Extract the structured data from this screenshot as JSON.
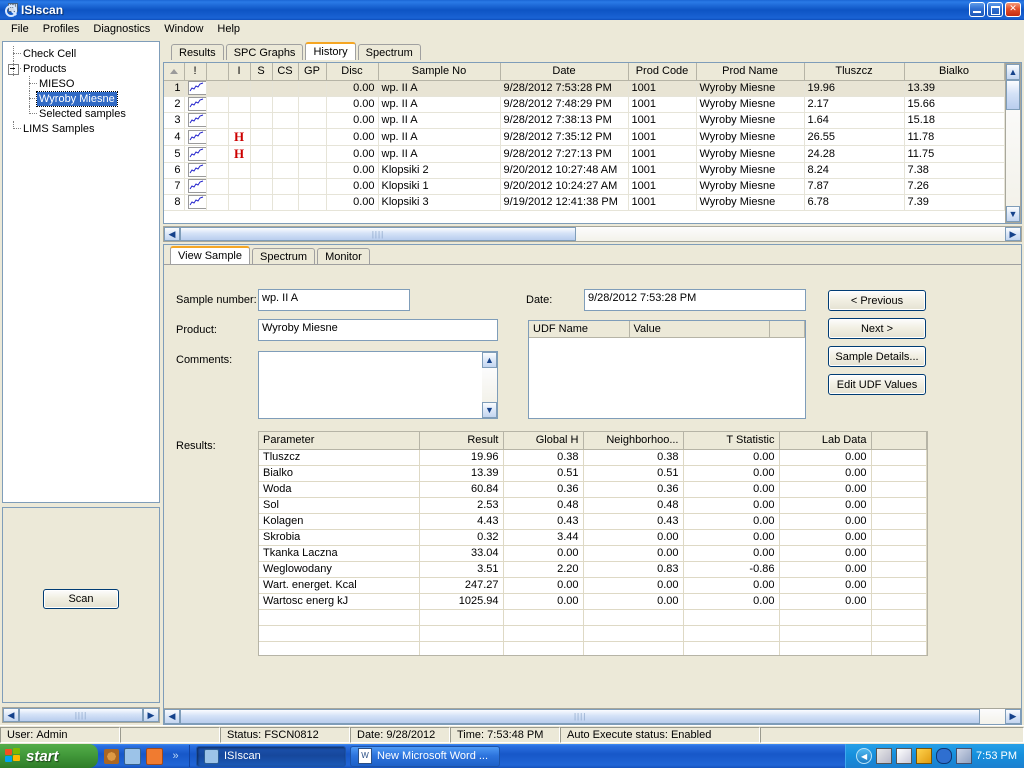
{
  "window": {
    "title": "ISIscan",
    "app_icon": "magnifier-isi-icon",
    "minimize_label": "Minimize",
    "restore_label": "Restore",
    "close_label": "Close"
  },
  "menu": [
    "File",
    "Profiles",
    "Diagnostics",
    "Window",
    "Help"
  ],
  "tree": [
    {
      "label": "Check Cell",
      "level": 1,
      "selected": false,
      "expander": false
    },
    {
      "label": "Products",
      "level": 1,
      "selected": false,
      "expander": true
    },
    {
      "label": "MIESO",
      "level": 2,
      "selected": false,
      "expander": false
    },
    {
      "label": "Wyroby Miesne",
      "level": 2,
      "selected": true,
      "expander": false
    },
    {
      "label": "Selected samples",
      "level": 2,
      "selected": false,
      "expander": false
    },
    {
      "label": "LIMS Samples",
      "level": 1,
      "selected": false,
      "expander": false
    }
  ],
  "scan": {
    "label": "Scan"
  },
  "main_tabs": [
    {
      "label": "Results",
      "active": false
    },
    {
      "label": "SPC Graphs",
      "active": false
    },
    {
      "label": "History",
      "active": true
    },
    {
      "label": "Spectrum",
      "active": false
    }
  ],
  "history_grid": {
    "columns": [
      "",
      "!",
      "",
      "I",
      "S",
      "CS",
      "GP",
      "Disc",
      "Sample No",
      "Date",
      "Prod Code",
      "Prod Name",
      "Tluszcz",
      "Bialko",
      ""
    ],
    "rows": [
      {
        "n": "1",
        "icon": "spectrum-icon",
        "flag": "",
        "i": "",
        "s": "",
        "cs": "",
        "gp": "",
        "disc": "0.00",
        "sample_no": "wp. II A",
        "date": "9/28/2012 7:53:28 PM",
        "prod_code": "1001",
        "prod_name": "Wyroby Miesne",
        "tluszcz": "19.96",
        "bialko": "13.39",
        "extra": "",
        "selected": true
      },
      {
        "n": "2",
        "icon": "spectrum-icon",
        "flag": "",
        "i": "",
        "s": "",
        "cs": "",
        "gp": "",
        "disc": "0.00",
        "sample_no": "wp. II A",
        "date": "9/28/2012 7:48:29 PM",
        "prod_code": "1001",
        "prod_name": "Wyroby Miesne",
        "tluszcz": "2.17",
        "bialko": "15.66",
        "extra": "",
        "selected": false
      },
      {
        "n": "3",
        "icon": "spectrum-icon",
        "flag": "",
        "i": "",
        "s": "",
        "cs": "",
        "gp": "",
        "disc": "0.00",
        "sample_no": "wp. II A",
        "date": "9/28/2012 7:38:13 PM",
        "prod_code": "1001",
        "prod_name": "Wyroby Miesne",
        "tluszcz": "1.64",
        "bialko": "15.18",
        "extra": "",
        "selected": false
      },
      {
        "n": "4",
        "icon": "spectrum-icon",
        "flag": "H",
        "i": "",
        "s": "",
        "cs": "",
        "gp": "",
        "disc": "0.00",
        "sample_no": "wp. II A",
        "date": "9/28/2012 7:35:12 PM",
        "prod_code": "1001",
        "prod_name": "Wyroby Miesne",
        "tluszcz": "26.55",
        "bialko": "11.78",
        "extra": "",
        "selected": false
      },
      {
        "n": "5",
        "icon": "spectrum-icon",
        "flag": "H",
        "i": "",
        "s": "",
        "cs": "",
        "gp": "",
        "disc": "0.00",
        "sample_no": "wp. II A",
        "date": "9/28/2012 7:27:13 PM",
        "prod_code": "1001",
        "prod_name": "Wyroby Miesne",
        "tluszcz": "24.28",
        "bialko": "11.75",
        "extra": "",
        "selected": false
      },
      {
        "n": "6",
        "icon": "spectrum-icon",
        "flag": "",
        "i": "",
        "s": "",
        "cs": "",
        "gp": "",
        "disc": "0.00",
        "sample_no": "Klopsiki  2",
        "date": "9/20/2012 10:27:48 AM",
        "prod_code": "1001",
        "prod_name": "Wyroby Miesne",
        "tluszcz": "8.24",
        "bialko": "7.38",
        "extra": "",
        "selected": false
      },
      {
        "n": "7",
        "icon": "spectrum-icon",
        "flag": "",
        "i": "",
        "s": "",
        "cs": "",
        "gp": "",
        "disc": "0.00",
        "sample_no": "Klopsiki  1",
        "date": "9/20/2012 10:24:27 AM",
        "prod_code": "1001",
        "prod_name": "Wyroby Miesne",
        "tluszcz": "7.87",
        "bialko": "7.26",
        "extra": "",
        "selected": false
      },
      {
        "n": "8",
        "icon": "spectrum-icon",
        "flag": "",
        "i": "",
        "s": "",
        "cs": "",
        "gp": "",
        "disc": "0.00",
        "sample_no": "Klopsiki  3",
        "date": "9/19/2012 12:41:38 PM",
        "prod_code": "1001",
        "prod_name": "Wyroby Miesne",
        "tluszcz": "6.78",
        "bialko": "7.39",
        "extra": "",
        "selected": false
      }
    ]
  },
  "lower_tabs": [
    {
      "label": "View Sample",
      "active": true
    },
    {
      "label": "Spectrum",
      "active": false
    },
    {
      "label": "Monitor",
      "active": false
    }
  ],
  "view_sample": {
    "sample_number_label": "Sample number:",
    "sample_number_value": "wp. II A",
    "product_label": "Product:",
    "product_value": "Wyroby Miesne",
    "comments_label": "Comments:",
    "comments_value": "",
    "date_label": "Date:",
    "date_value": "9/28/2012 7:53:28 PM",
    "results_label": "Results:"
  },
  "udf_table": {
    "columns": [
      "UDF Name",
      "Value",
      ""
    ],
    "rows": []
  },
  "buttons": [
    {
      "label": "< Previous",
      "name": "previous-button"
    },
    {
      "label": "Next >",
      "name": "next-button"
    },
    {
      "label": "Sample Details...",
      "name": "sample-details-button"
    },
    {
      "label": "Edit UDF Values",
      "name": "edit-udf-values-button"
    }
  ],
  "results_table": {
    "columns": [
      "Parameter",
      "Result",
      "Global H",
      "Neighborhoo...",
      "T Statistic",
      "Lab Data",
      ""
    ],
    "rows": [
      {
        "parameter": "Tluszcz",
        "result": "19.96",
        "global_h": "0.38",
        "neighborhood": "0.38",
        "t_statistic": "0.00",
        "lab_data": "0.00"
      },
      {
        "parameter": "Bialko",
        "result": "13.39",
        "global_h": "0.51",
        "neighborhood": "0.51",
        "t_statistic": "0.00",
        "lab_data": "0.00"
      },
      {
        "parameter": "Woda",
        "result": "60.84",
        "global_h": "0.36",
        "neighborhood": "0.36",
        "t_statistic": "0.00",
        "lab_data": "0.00"
      },
      {
        "parameter": "Sol",
        "result": "2.53",
        "global_h": "0.48",
        "neighborhood": "0.48",
        "t_statistic": "0.00",
        "lab_data": "0.00"
      },
      {
        "parameter": "Kolagen",
        "result": "4.43",
        "global_h": "0.43",
        "neighborhood": "0.43",
        "t_statistic": "0.00",
        "lab_data": "0.00"
      },
      {
        "parameter": "Skrobia",
        "result": "0.32",
        "global_h": "3.44",
        "neighborhood": "0.00",
        "t_statistic": "0.00",
        "lab_data": "0.00"
      },
      {
        "parameter": "Tkanka Laczna",
        "result": "33.04",
        "global_h": "0.00",
        "neighborhood": "0.00",
        "t_statistic": "0.00",
        "lab_data": "0.00"
      },
      {
        "parameter": "Weglowodany",
        "result": "3.51",
        "global_h": "2.20",
        "neighborhood": "0.83",
        "t_statistic": "-0.86",
        "lab_data": "0.00"
      },
      {
        "parameter": "Wart. energet. Kcal",
        "result": "247.27",
        "global_h": "0.00",
        "neighborhood": "0.00",
        "t_statistic": "0.00",
        "lab_data": "0.00"
      },
      {
        "parameter": "Wartosc energ kJ",
        "result": "1025.94",
        "global_h": "0.00",
        "neighborhood": "0.00",
        "t_statistic": "0.00",
        "lab_data": "0.00"
      }
    ]
  },
  "statusbar": {
    "user_label": "User:",
    "user_value": "Admin",
    "status_label": "Status:",
    "status_value": "FSCN0812",
    "date_label": "Date:",
    "date_value": "9/28/2012",
    "time_label": "Time:",
    "time_value": "7:53:48 PM",
    "auto_label": "Auto Execute status:",
    "auto_value": "Enabled"
  },
  "taskbar": {
    "start_label": "start",
    "quick_launch": [
      "media-icon",
      "isiscan-icon",
      "grid-app-icon",
      "chevron-double-right-icon"
    ],
    "tasks": [
      {
        "label": "ISIscan",
        "icon": "magnifier-isi-icon",
        "active": true
      },
      {
        "label": "New Microsoft Word ...",
        "icon": "word-doc-icon",
        "active": false
      }
    ],
    "tray_icons": [
      "chevron-left-icon",
      "volume-icon",
      "task-scheduler-icon",
      "display-icon",
      "shortcut-icon",
      "network-icon"
    ],
    "clock": "7:53 PM"
  }
}
